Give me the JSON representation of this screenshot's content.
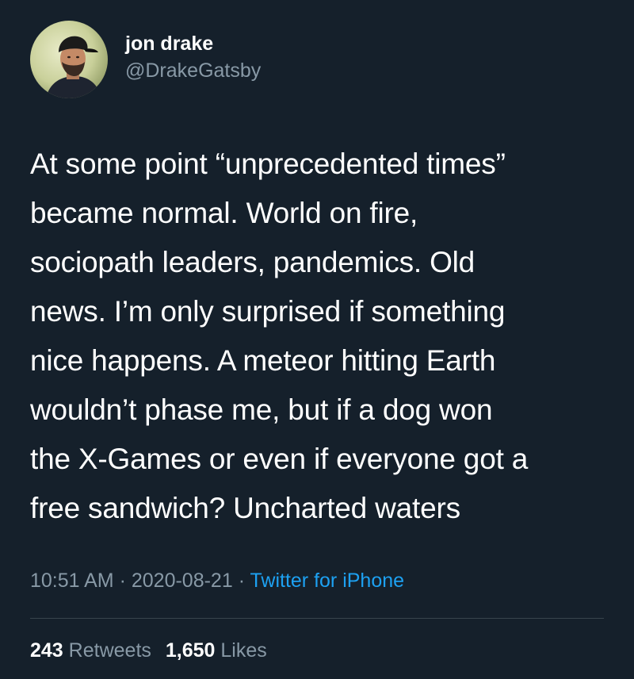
{
  "tweet": {
    "author": {
      "display_name": "jon drake",
      "handle": "@DrakeGatsby",
      "avatar_icon": "profile-photo"
    },
    "text_lines": [
      "At some point “unprecedented times”",
      "became normal. World on fire,",
      "sociopath leaders, pandemics. Old",
      "news. I’m only surprised if something",
      "nice happens. A meteor hitting Earth",
      "wouldn’t phase me, but if a dog won",
      "the X-Games or even if everyone got a",
      "free sandwich? Uncharted waters"
    ],
    "time": "10:51 AM",
    "separator": " · ",
    "date": "2020-08-21",
    "source": "Twitter for iPhone",
    "retweets_count": "243",
    "retweets_label": "Retweets",
    "likes_count": "1,650",
    "likes_label": "Likes"
  },
  "colors": {
    "background": "#15202b",
    "text": "#ffffff",
    "secondary": "#8899a6",
    "link": "#1da1f2",
    "divider": "#38444d"
  }
}
